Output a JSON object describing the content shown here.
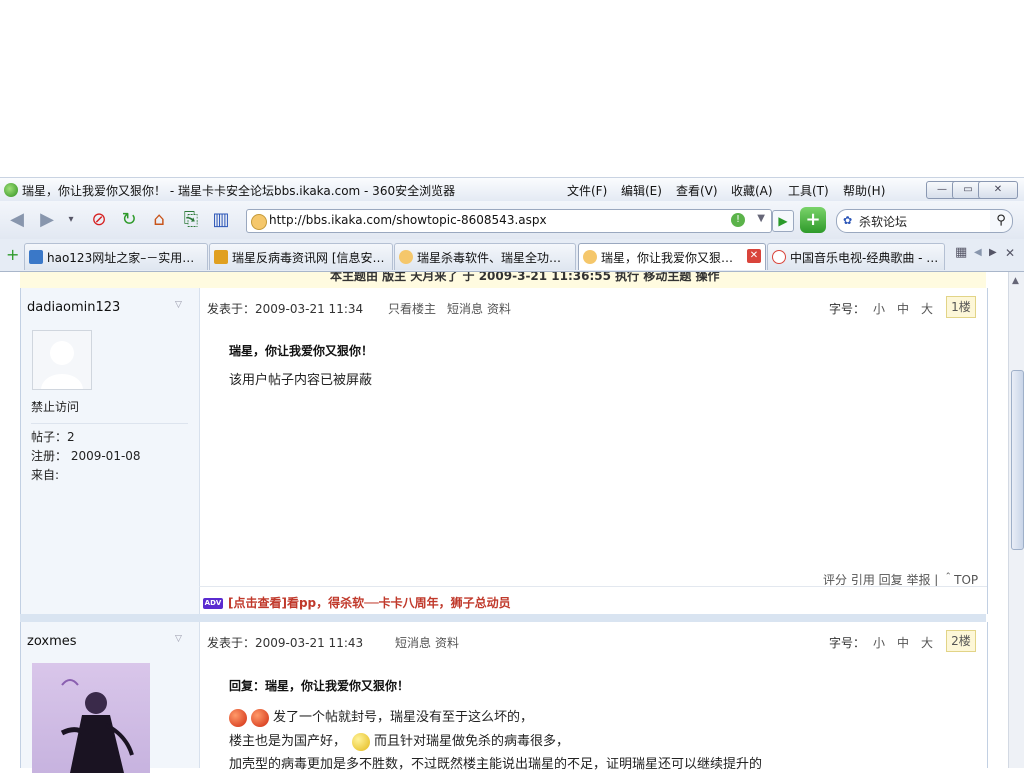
{
  "window": {
    "title": "瑞星，你让我爱你又狠你！ - 瑞星卡卡安全论坛bbs.ikaka.com - 360安全浏览器",
    "menus": [
      "文件(F)",
      "编辑(E)",
      "查看(V)",
      "收藏(A)",
      "工具(T)",
      "帮助(H)"
    ],
    "buttons": {
      "minimize": "—",
      "maximize": "▭",
      "close": "✕"
    }
  },
  "toolbar": {
    "url": "http://bbs.ikaka.com/showtopic-8608543.aspx",
    "search_value": "杀软论坛",
    "go": "▶",
    "shield": "+"
  },
  "tabs": [
    {
      "label": "hao123网址之家–－实用…",
      "color": "#3a78c8"
    },
    {
      "label": "瑞星反病毒资讯网 [信息安…",
      "color": "#e0a020"
    },
    {
      "label": "瑞星杀毒软件、瑞星全功…",
      "color": "#f5c76b"
    },
    {
      "label": "瑞星，你让我爱你又狠…",
      "color": "#f5c76b",
      "active": true
    },
    {
      "label": "中国音乐电视-经典歌曲 - …",
      "color": "#d9443b"
    }
  ],
  "tabbar": {
    "add": "+",
    "grid": "▦",
    "prev": "◀",
    "next": "▶",
    "close": "✕"
  },
  "notice": "本主题由 版主 天月来了 于 2009-3-21 11:36:55 执行 移动主题 操作",
  "posts": [
    {
      "username": "dadiaomin123",
      "posted": "发表于：2009-03-21 11:34",
      "links": [
        "只看楼主",
        "短消息",
        "资料"
      ],
      "fontsize_label": "字号：",
      "sizes": [
        "小",
        "中",
        "大"
      ],
      "floor": "1楼",
      "status": "禁止访问",
      "posts_count": "帖子：2",
      "registered": "注册：  2009-01-08",
      "from": "来自:",
      "title": "瑞星，你让我爱你又狠你！",
      "body": "该用户帖子内容已被屏蔽",
      "ops": "评分 引用 回复 举报 | ＾TOP",
      "ad_badge": "ADV",
      "ad": "[点击查看]看pp，得杀软──卡卡八周年，狮子总动员"
    },
    {
      "username": "zoxmes",
      "posted": "发表于：2009-03-21 11:43",
      "links": [
        "短消息",
        "资料"
      ],
      "fontsize_label": "字号：",
      "sizes": [
        "小",
        "中",
        "大"
      ],
      "floor": "2楼",
      "title": "回复：瑞星，你让我爱你又狠你！",
      "line1": "发了一个帖就封号，瑞星没有至于这么坏的，",
      "line2a": "楼主也是为国产好，",
      "line2b": "而且针对瑞星做免杀的病毒很多，",
      "line3": "加壳型的病毒更加是多不胜数，不过既然楼主能说出瑞星的不足，证明瑞星还可以继续提升的"
    }
  ]
}
